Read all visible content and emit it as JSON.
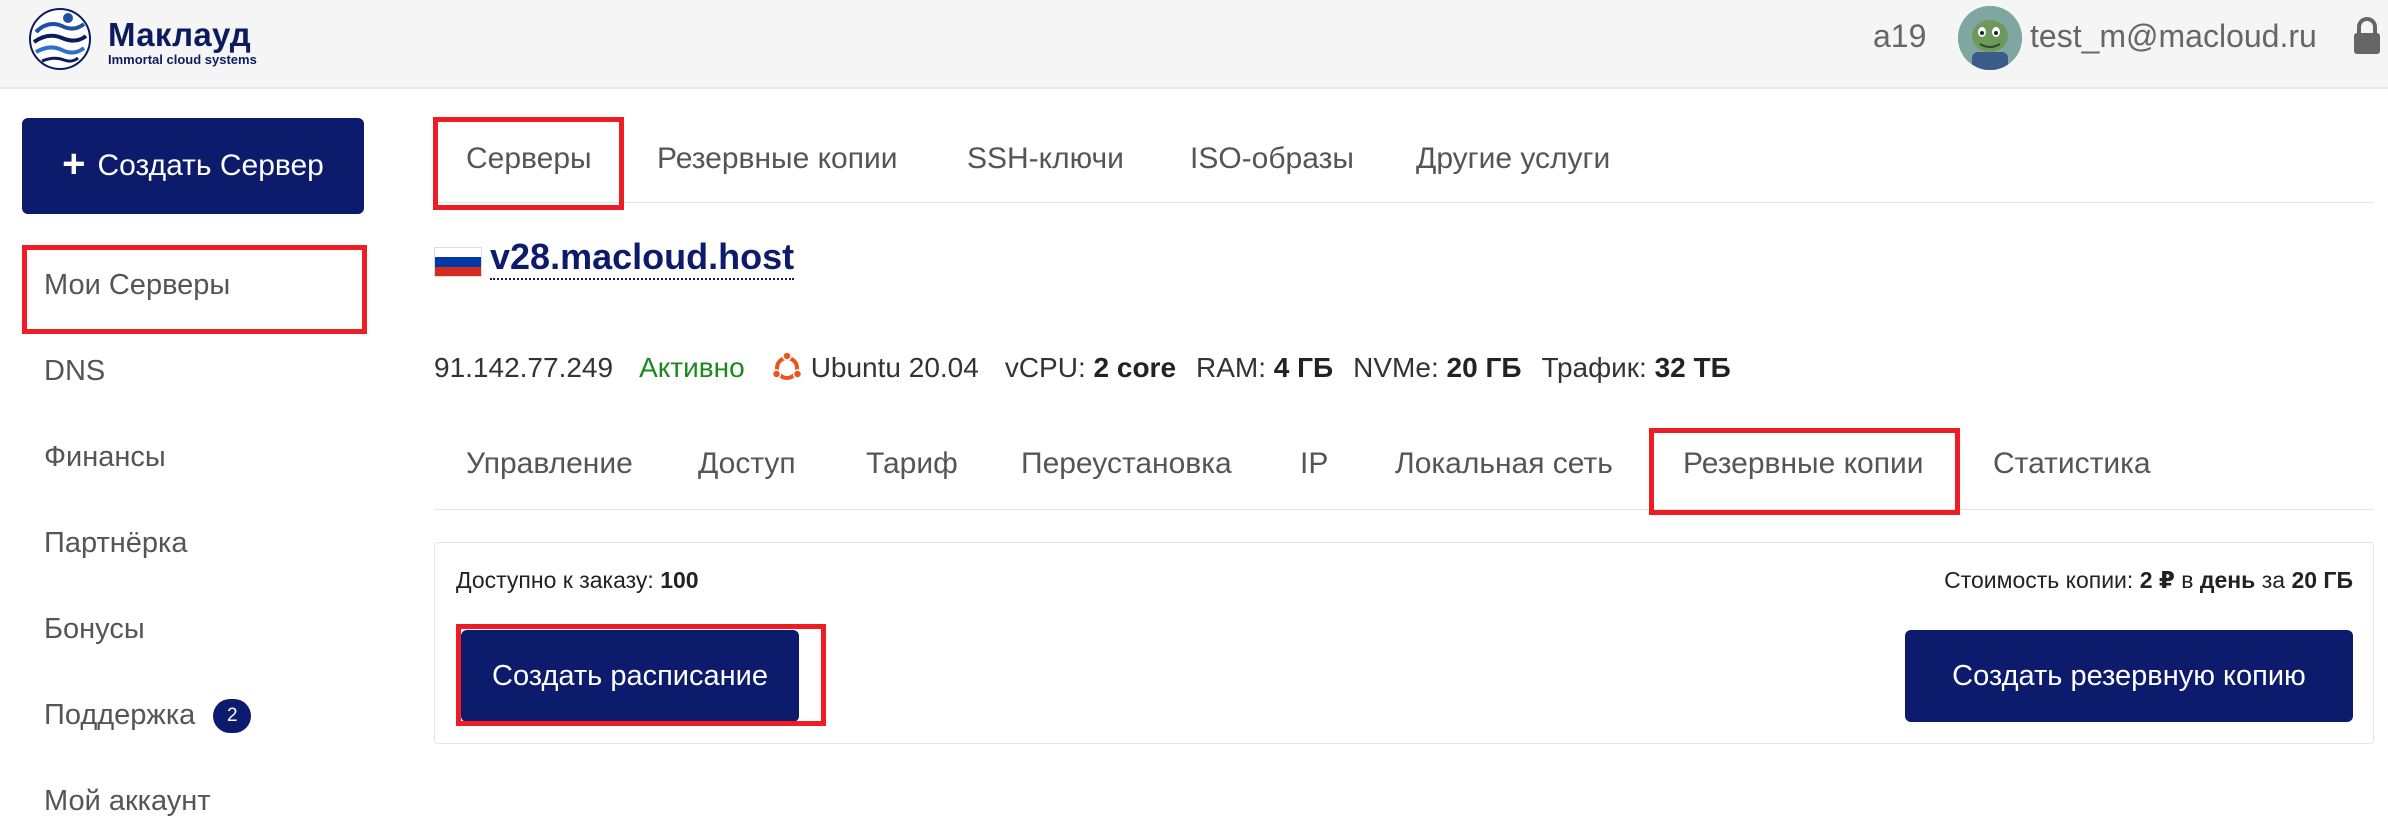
{
  "header": {
    "logo_name": "Маклауд",
    "logo_tagline": "Immortal cloud systems",
    "account_code": "a19",
    "user_email": "test_m@macloud.ru",
    "icons": {
      "logo": "macloud-logo-icon",
      "avatar": "user-avatar",
      "lock": "lock-icon"
    }
  },
  "sidebar": {
    "create_button": "Создать Сервер",
    "items": [
      {
        "label": "Мои Серверы"
      },
      {
        "label": "DNS"
      },
      {
        "label": "Финансы"
      },
      {
        "label": "Партнёрка"
      },
      {
        "label": "Бонусы"
      },
      {
        "label": "Поддержка",
        "badge": "2"
      },
      {
        "label": "Мой аккаунт"
      }
    ]
  },
  "top_tabs": [
    "Серверы",
    "Резервные копии",
    "SSH-ключи",
    "ISO-образы",
    "Другие услуги"
  ],
  "server": {
    "hostname": "v28.macloud.host",
    "flag": "russia-flag-icon",
    "ip": "91.142.77.249",
    "status": "Активно",
    "os": "Ubuntu 20.04",
    "vcpu_label": "vCPU:",
    "vcpu_value": "2 core",
    "ram_label": "RAM:",
    "ram_value": "4 ГБ",
    "nvme_label": "NVMe:",
    "nvme_value": "20 ГБ",
    "traffic_label": "Трафик:",
    "traffic_value": "32 ТБ"
  },
  "sub_tabs": [
    "Управление",
    "Доступ",
    "Тариф",
    "Переустановка",
    "IP",
    "Локальная сеть",
    "Резервные копии",
    "Статистика"
  ],
  "backups": {
    "available_label": "Доступно к заказу:",
    "available_value": "100",
    "cost_label": "Стоимость копии:",
    "cost_price": "2 ₽",
    "cost_in": "в",
    "cost_period": "день",
    "cost_for": "за",
    "cost_size": "20 ГБ",
    "schedule_button": "Создать расписание",
    "backup_button": "Создать резервную копию"
  },
  "colors": {
    "brand_navy": "#0c1b6b",
    "highlight_red": "#ee1c25",
    "status_green": "#1a8a1a",
    "header_bg": "#f5f5f5"
  }
}
